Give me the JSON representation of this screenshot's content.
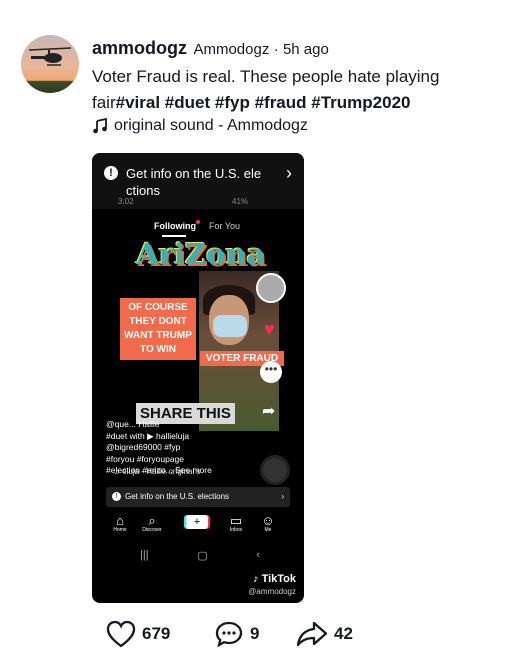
{
  "post": {
    "username": "ammodogz",
    "nickname": "Ammodogz",
    "time_ago": "· 5h ago",
    "caption_text": "Voter Fraud is real. These people hate playing fair",
    "hashtags": [
      "#viral",
      "#duet",
      "#fyp",
      "#fraud",
      "#Trump2020"
    ],
    "sound": "original sound - Ammodogz"
  },
  "video": {
    "banner": "Get info on the U.S. ele ctions",
    "status_time": "3:02",
    "status_icons": "41%",
    "tab_following": "Following",
    "tab_foryou": "For You",
    "title_overlay": "AriZona",
    "overlay_left": "OF COURSE THEY DONT WANT TRUMP TO WIN",
    "overlay_right": "VOTER FRAUD",
    "share_overlay": "SHARE THIS",
    "lines": [
      "@que... Hallie",
      "#duet with ▶ hallieluja",
      "@bigred69000 #fyp",
      "#foryou #foryoupage",
      "#election #arizo... See more"
    ],
    "music_row": "♫ eluja - Hallie   original s",
    "getinfo": "Get info on the U.S. elections",
    "nav": [
      "Home",
      "Discover",
      "",
      "Inbox",
      "Me"
    ],
    "brand": "TikTok",
    "handle": "@ammodogz"
  },
  "actions": {
    "likes": "679",
    "comments": "9",
    "shares": "42"
  },
  "icons": [
    "helicopter-avatar",
    "music-note-icon",
    "heart-icon",
    "comment-icon",
    "share-icon"
  ]
}
